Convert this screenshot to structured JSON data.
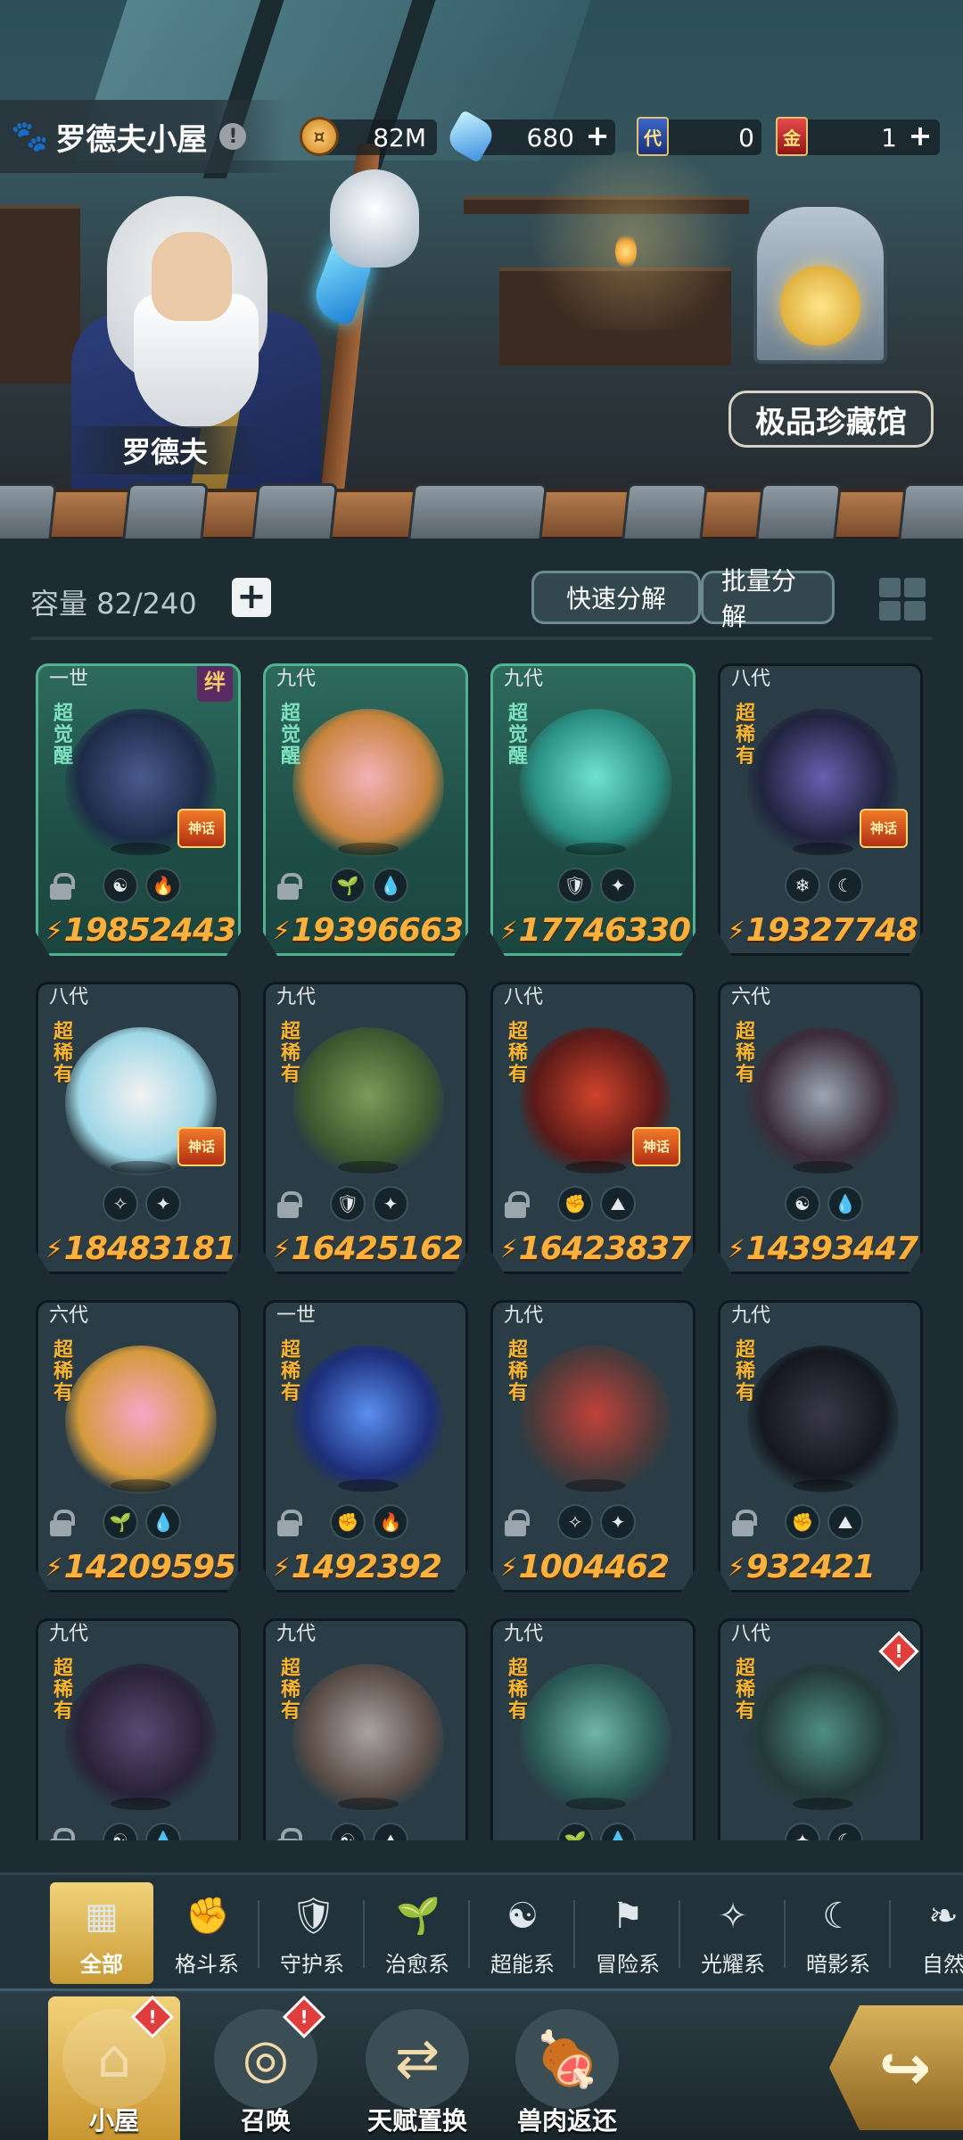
{
  "header": {
    "title": "罗德夫小屋",
    "info_icon": "!",
    "resources": [
      {
        "name": "gold-coin",
        "value": "82M",
        "has_plus": false
      },
      {
        "name": "crystal-gem",
        "value": "680",
        "has_plus": true
      },
      {
        "name": "generation-card",
        "value": "0",
        "has_plus": false,
        "icon_text": "代"
      },
      {
        "name": "gold-card",
        "value": "1",
        "has_plus": true,
        "icon_text": "金"
      }
    ],
    "plus": "+"
  },
  "scene": {
    "npc_name": "罗德夫",
    "collection_hall": "极品珍藏馆"
  },
  "inventory": {
    "capacity_label": "容量 82/240",
    "plus": "+",
    "quick_decompose": "快速分解",
    "batch_decompose": "批量分解",
    "cards": [
      {
        "gen": "一世",
        "rarity": "超觉醒",
        "awakened": true,
        "bond": "绊",
        "myth": "神话",
        "locked": true,
        "elements": [
          "☯",
          "🔥"
        ],
        "power": "19852443",
        "palette": [
          "#4a5a8e",
          "#1e2b48"
        ]
      },
      {
        "gen": "九代",
        "rarity": "超觉醒",
        "awakened": true,
        "myth": "",
        "locked": true,
        "elements": [
          "🌱",
          "💧"
        ],
        "power": "19396663",
        "palette": [
          "#f4b1b8",
          "#c7843e"
        ]
      },
      {
        "gen": "九代",
        "rarity": "超觉醒",
        "awakened": true,
        "myth": "",
        "locked": false,
        "elements": [
          "🛡",
          "✦"
        ],
        "power": "17746330",
        "palette": [
          "#6fe3cf",
          "#2b8f84"
        ]
      },
      {
        "gen": "八代",
        "rarity": "超稀有",
        "awakened": false,
        "myth": "神话",
        "locked": false,
        "elements": [
          "❄",
          "☾"
        ],
        "power": "19327748",
        "palette": [
          "#6a5fb0",
          "#20243e"
        ]
      },
      {
        "gen": "八代",
        "rarity": "超稀有",
        "awakened": false,
        "myth": "神话",
        "locked": false,
        "elements": [
          "✧",
          "✦"
        ],
        "power": "18483181",
        "palette": [
          "#f2f2f2",
          "#9fd7e6"
        ]
      },
      {
        "gen": "九代",
        "rarity": "超稀有",
        "awakened": false,
        "myth": "",
        "locked": true,
        "elements": [
          "🛡",
          "✦"
        ],
        "power": "16425162",
        "palette": [
          "#7c9b58",
          "#3c5a2e"
        ]
      },
      {
        "gen": "八代",
        "rarity": "超稀有",
        "awakened": false,
        "myth": "神话",
        "locked": true,
        "elements": [
          "✊",
          "⛰"
        ],
        "power": "16423837",
        "palette": [
          "#d0432c",
          "#5b1a18"
        ]
      },
      {
        "gen": "六代",
        "rarity": "超稀有",
        "awakened": false,
        "myth": "",
        "locked": false,
        "elements": [
          "☯",
          "💧"
        ],
        "power": "14393447",
        "palette": [
          "#9aa7b3",
          "#3b2b3a"
        ]
      },
      {
        "gen": "六代",
        "rarity": "超稀有",
        "awakened": false,
        "myth": "",
        "locked": true,
        "elements": [
          "🌱",
          "💧"
        ],
        "power": "14209595",
        "palette": [
          "#f6a6c9",
          "#d59a3c"
        ]
      },
      {
        "gen": "一世",
        "rarity": "超稀有",
        "awakened": false,
        "myth": "",
        "locked": true,
        "elements": [
          "✊",
          "🔥"
        ],
        "power": "1492392",
        "palette": [
          "#5a8ff0",
          "#1d2e7a"
        ]
      },
      {
        "gen": "九代",
        "rarity": "超稀有",
        "awakened": false,
        "myth": "",
        "locked": true,
        "elements": [
          "✧",
          "✦"
        ],
        "power": "1004462",
        "palette": [
          "#c1413a",
          "#4a3a3a"
        ]
      },
      {
        "gen": "九代",
        "rarity": "超稀有",
        "awakened": false,
        "myth": "",
        "locked": true,
        "elements": [
          "✊",
          "⛰"
        ],
        "power": "932421",
        "palette": [
          "#3a3848",
          "#141820"
        ]
      },
      {
        "gen": "九代",
        "rarity": "超稀有",
        "awakened": false,
        "myth": "",
        "locked": true,
        "elements": [
          "☯",
          "💧"
        ],
        "power": "",
        "palette": [
          "#574a73",
          "#2a2238"
        ]
      },
      {
        "gen": "九代",
        "rarity": "超稀有",
        "awakened": false,
        "myth": "",
        "locked": true,
        "elements": [
          "☯",
          "⛰"
        ],
        "power": "",
        "palette": [
          "#a9a3a0",
          "#5a4c46"
        ]
      },
      {
        "gen": "九代",
        "rarity": "超稀有",
        "awakened": false,
        "myth": "",
        "locked": false,
        "elements": [
          "🌱",
          "💧"
        ],
        "power": "",
        "palette": [
          "#6fb7ab",
          "#2a5a55"
        ]
      },
      {
        "gen": "八代",
        "rarity": "超稀有",
        "awakened": false,
        "myth": "",
        "locked": false,
        "alert": "!",
        "elements": [
          "✦",
          "☾"
        ],
        "power": "",
        "palette": [
          "#4f8e86",
          "#243a38"
        ]
      }
    ]
  },
  "filters": [
    {
      "label": "全部",
      "icon": "▦",
      "icon_name": "all-icon",
      "active": true
    },
    {
      "label": "格斗系",
      "icon": "✊",
      "icon_name": "fist-icon",
      "active": false
    },
    {
      "label": "守护系",
      "icon": "🛡",
      "icon_name": "shield-icon",
      "active": false
    },
    {
      "label": "治愈系",
      "icon": "🌱",
      "icon_name": "sprout-icon",
      "active": false
    },
    {
      "label": "超能系",
      "icon": "☯",
      "icon_name": "alien-icon",
      "active": false
    },
    {
      "label": "冒险系",
      "icon": "⚑",
      "icon_name": "adventure-icon",
      "active": false
    },
    {
      "label": "光耀系",
      "icon": "✧",
      "icon_name": "radiance-icon",
      "active": false
    },
    {
      "label": "暗影系",
      "icon": "☾",
      "icon_name": "shadow-icon",
      "active": false
    },
    {
      "label": "自然",
      "icon": "❧",
      "icon_name": "nature-icon",
      "active": false
    }
  ],
  "bottom_nav": [
    {
      "label": "小屋",
      "icon": "⌂",
      "icon_name": "cabin-icon",
      "active": true,
      "alert": "!"
    },
    {
      "label": "召唤",
      "icon": "◎",
      "icon_name": "egg-icon",
      "active": false,
      "alert": "!"
    },
    {
      "label": "天赋置换",
      "icon": "⇄",
      "icon_name": "swap-icon",
      "active": false,
      "alert": ""
    },
    {
      "label": "兽肉返还",
      "icon": "🍖",
      "icon_name": "meat-icon",
      "active": false,
      "alert": ""
    }
  ],
  "share_icon": "↪",
  "colors": {
    "accent_gold": "#f1d37a",
    "power_orange": "#ffb13b",
    "awakened_green": "#2d6a5c"
  }
}
